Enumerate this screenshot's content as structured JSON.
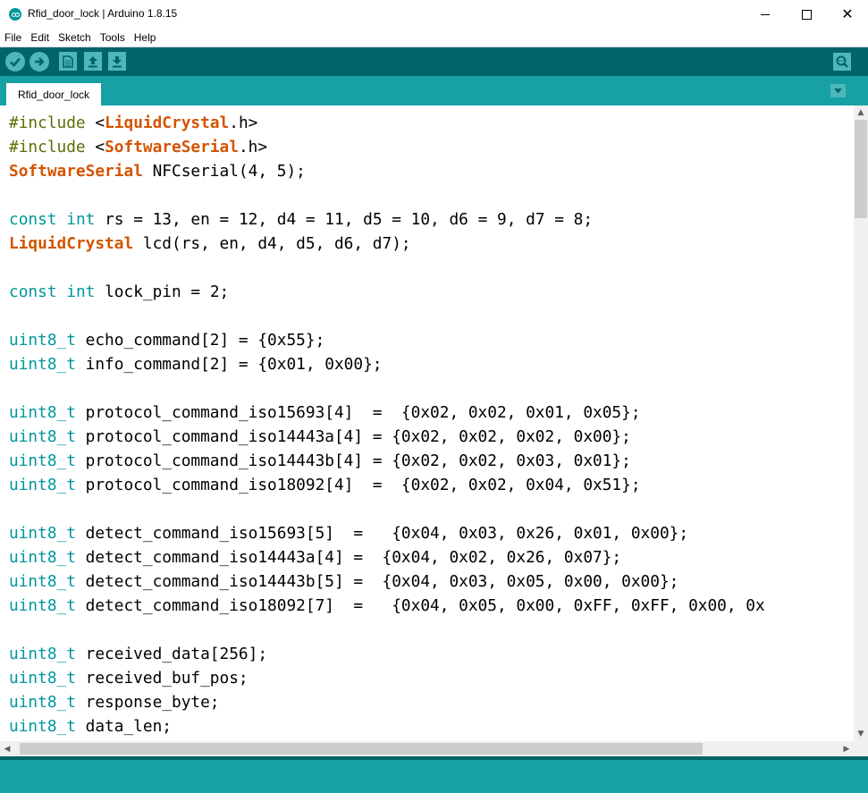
{
  "window": {
    "title": "Rfid_door_lock | Arduino 1.8.15",
    "minimize_label": "",
    "close_glyph": "✕"
  },
  "menu": [
    "File",
    "Edit",
    "Sketch",
    "Tools",
    "Help"
  ],
  "toolbar": {
    "buttons": [
      "verify-icon",
      "upload-icon",
      "new-icon",
      "open-icon",
      "save-icon"
    ],
    "right": "serial-monitor-icon"
  },
  "tab": {
    "label": "Rfid_door_lock",
    "menu_icon": "tab-menu-icon"
  },
  "colors": {
    "toolbar": "#006468",
    "tabbar": "#17a1a5",
    "button": "#4db7bb",
    "keyword": "#00979c",
    "type": "#d35400",
    "preprocessor": "#5e6d03"
  },
  "code_lines": [
    [
      [
        "pp",
        "#include "
      ],
      [
        "",
        "<"
      ],
      [
        "ty",
        "LiquidCrystal"
      ],
      [
        "",
        ".h>"
      ]
    ],
    [
      [
        "pp",
        "#include "
      ],
      [
        "",
        "<"
      ],
      [
        "ty",
        "SoftwareSerial"
      ],
      [
        "",
        ".h>"
      ]
    ],
    [
      [
        "ty",
        "SoftwareSerial"
      ],
      [
        "",
        " NFCserial(4, 5);"
      ]
    ],
    [],
    [
      [
        "kw",
        "const"
      ],
      [
        "",
        " "
      ],
      [
        "kw",
        "int"
      ],
      [
        "",
        " rs = 13, en = 12, d4 = 11, d5 = 10, d6 = 9, d7 = 8;"
      ]
    ],
    [
      [
        "ty",
        "LiquidCrystal"
      ],
      [
        "",
        " lcd(rs, en, d4, d5, d6, d7);"
      ]
    ],
    [],
    [
      [
        "kw",
        "const"
      ],
      [
        "",
        " "
      ],
      [
        "kw",
        "int"
      ],
      [
        "",
        " lock_pin = 2;"
      ]
    ],
    [],
    [
      [
        "kw",
        "uint8_t"
      ],
      [
        "",
        " echo_command[2] = {0x55};"
      ]
    ],
    [
      [
        "kw",
        "uint8_t"
      ],
      [
        "",
        " info_command[2] = {0x01, 0x00};"
      ]
    ],
    [],
    [
      [
        "kw",
        "uint8_t"
      ],
      [
        "",
        " protocol_command_iso15693[4]  =  {0x02, 0x02, 0x01, 0x05};"
      ]
    ],
    [
      [
        "kw",
        "uint8_t"
      ],
      [
        "",
        " protocol_command_iso14443a[4] = {0x02, 0x02, 0x02, 0x00};"
      ]
    ],
    [
      [
        "kw",
        "uint8_t"
      ],
      [
        "",
        " protocol_command_iso14443b[4] = {0x02, 0x02, 0x03, 0x01};"
      ]
    ],
    [
      [
        "kw",
        "uint8_t"
      ],
      [
        "",
        " protocol_command_iso18092[4]  =  {0x02, 0x02, 0x04, 0x51};"
      ]
    ],
    [],
    [
      [
        "kw",
        "uint8_t"
      ],
      [
        "",
        " detect_command_iso15693[5]  =   {0x04, 0x03, 0x26, 0x01, 0x00};"
      ]
    ],
    [
      [
        "kw",
        "uint8_t"
      ],
      [
        "",
        " detect_command_iso14443a[4] =  {0x04, 0x02, 0x26, 0x07};"
      ]
    ],
    [
      [
        "kw",
        "uint8_t"
      ],
      [
        "",
        " detect_command_iso14443b[5] =  {0x04, 0x03, 0x05, 0x00, 0x00};"
      ]
    ],
    [
      [
        "kw",
        "uint8_t"
      ],
      [
        "",
        " detect_command_iso18092[7]  =   {0x04, 0x05, 0x00, 0xFF, 0xFF, 0x00, 0x"
      ]
    ],
    [],
    [
      [
        "kw",
        "uint8_t"
      ],
      [
        "",
        " received_data[256];"
      ]
    ],
    [
      [
        "kw",
        "uint8_t"
      ],
      [
        "",
        " received_buf_pos;"
      ]
    ],
    [
      [
        "kw",
        "uint8_t"
      ],
      [
        "",
        " response_byte;"
      ]
    ],
    [
      [
        "kw",
        "uint8_t"
      ],
      [
        "",
        " data_len;"
      ]
    ]
  ],
  "scrollbars": {
    "up": "▲",
    "down": "▼",
    "left": "◀",
    "right": "▶"
  }
}
